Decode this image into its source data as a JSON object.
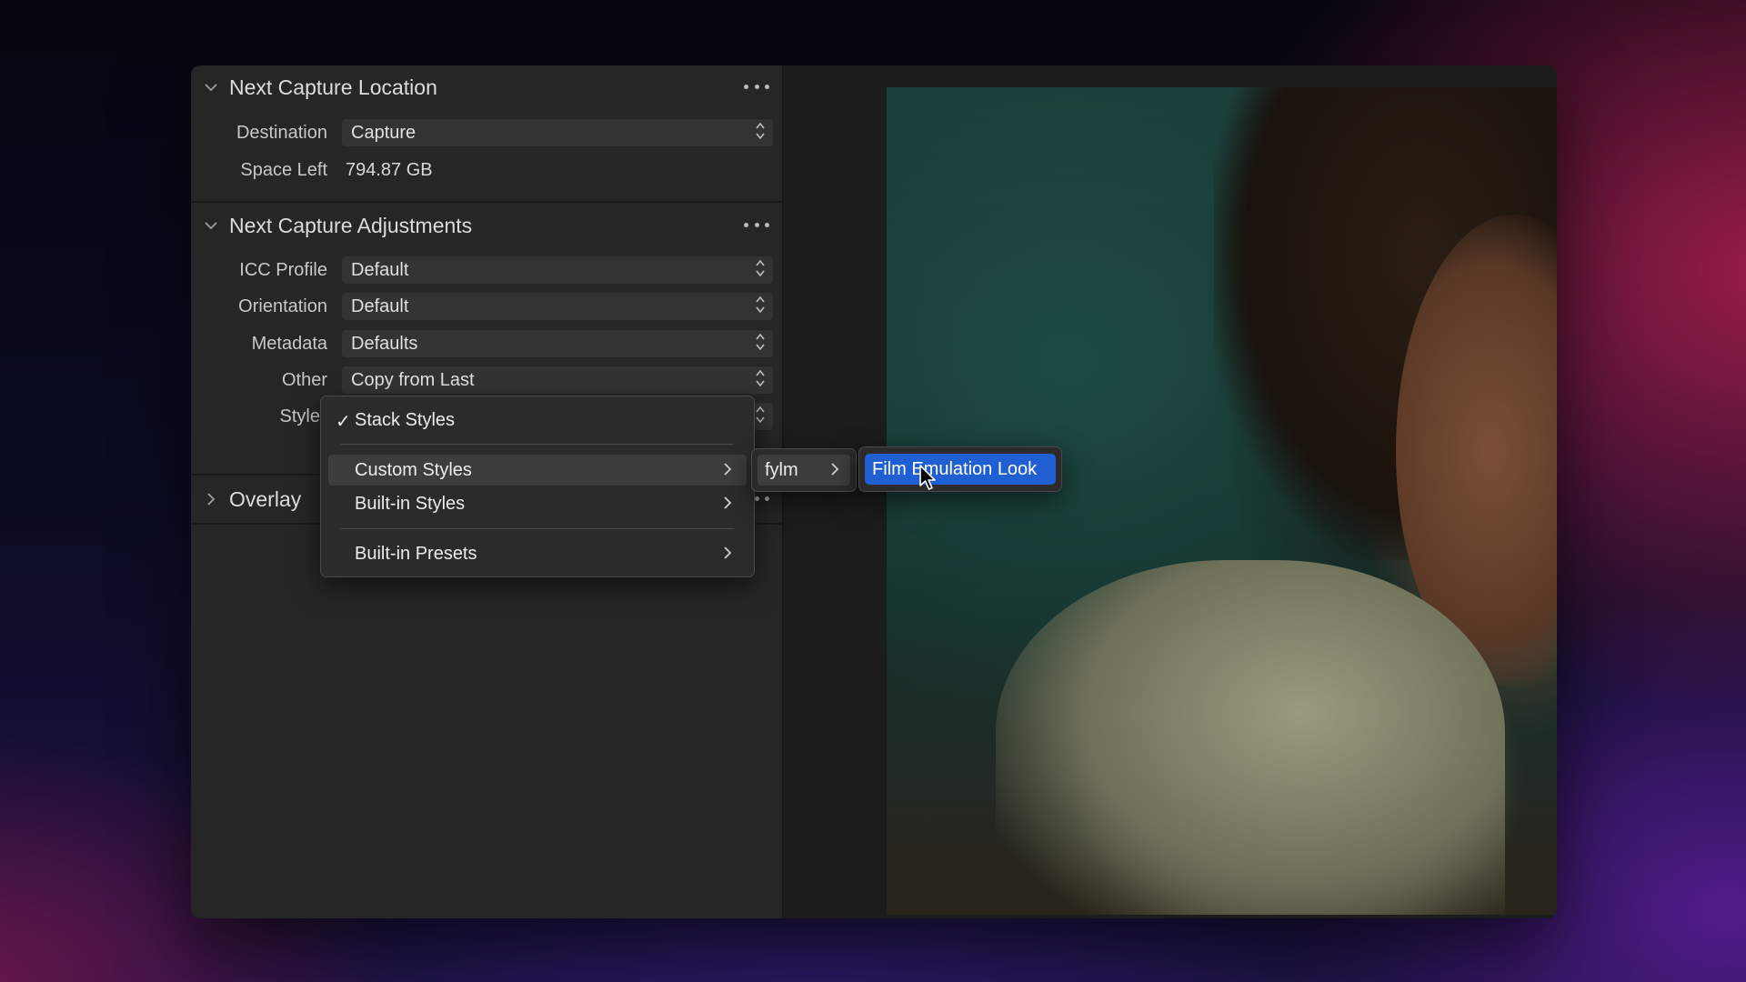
{
  "sections": {
    "capture_location": {
      "title": "Next Capture Location",
      "destination": {
        "label": "Destination",
        "value": "Capture"
      },
      "space_left": {
        "label": "Space Left",
        "value": "794.87 GB"
      }
    },
    "capture_adjustments": {
      "title": "Next Capture Adjustments",
      "icc_profile": {
        "label": "ICC Profile",
        "value": "Default"
      },
      "orientation": {
        "label": "Orientation",
        "value": "Default"
      },
      "metadata": {
        "label": "Metadata",
        "value": "Defaults"
      },
      "other": {
        "label": "Other",
        "value": "Copy from Last"
      },
      "styles": {
        "label": "Styles"
      }
    },
    "overlay": {
      "title": "Overlay"
    }
  },
  "styles_menu": {
    "stack_styles": {
      "label": "Stack Styles",
      "checked": true,
      "check": "✓"
    },
    "items": [
      {
        "label": "Custom Styles",
        "has_submenu": true
      },
      {
        "label": "Built-in Styles",
        "has_submenu": true
      },
      {
        "label": "Built-in Presets",
        "has_submenu": true
      }
    ],
    "submenu_level1": {
      "label": "fylm",
      "has_submenu": true
    },
    "submenu_level2": {
      "label": "Film Emulation Look",
      "highlighted": true,
      "highlight_color": "#1f5fd1"
    }
  },
  "icons": {
    "expanded": "chevron-down-icon",
    "collapsed": "chevron-right-icon",
    "more": "more-horizontal-icon",
    "select": "up-down-arrows-icon",
    "submenu": "chevron-right-icon"
  }
}
